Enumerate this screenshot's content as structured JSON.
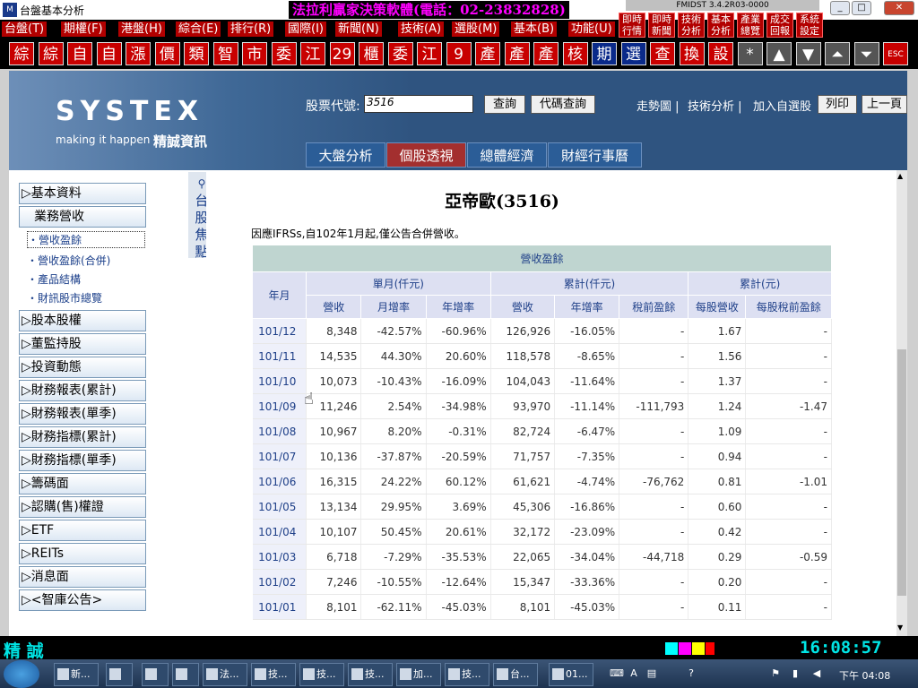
{
  "window": {
    "title": "台盤基本分析",
    "ad": "法拉利贏家決策軟體(電話：02-23832828)",
    "version": "FMIDST 3.4.2R03-0000"
  },
  "menu": [
    "台盤(T)",
    "期權(F)",
    "港盤(H)",
    "綜合(E)",
    "排行(R)",
    "國際(I)",
    "新聞(N)",
    "技術(A)",
    "選股(M)",
    "基本(B)",
    "功能(U)"
  ],
  "quick": [
    "即時行情",
    "即時新聞",
    "技術分析",
    "基本分析",
    "產業總覽",
    "成交回報",
    "系統設定"
  ],
  "toolbar": [
    "綜",
    "綜",
    "自",
    "自",
    "漲",
    "價",
    "類",
    "智",
    "市",
    "委",
    "江",
    "29",
    "櫃",
    "委",
    "江",
    "9",
    "產",
    "產",
    "產",
    "核",
    "期",
    "選",
    "查",
    "換",
    "設",
    "*",
    "▲",
    "▼",
    "⏶",
    "⏷",
    "ESC"
  ],
  "banner": {
    "brand": "SYSTEX",
    "tagline": "making it happen",
    "company": "精誠資訊",
    "stock_label": "股票代號:",
    "stock_value": "3516",
    "query": "查詢",
    "code_query": "代碼查詢",
    "links": [
      "走勢圖 |",
      "技術分析 |",
      "加入自選股"
    ],
    "print": "列印",
    "prev": "上一頁",
    "tabs": [
      "大盤分析",
      "個股透視",
      "總體經濟",
      "財經行事曆"
    ]
  },
  "sidebar": {
    "vtab": [
      "台",
      "股",
      "焦",
      "點"
    ],
    "items": [
      "▷基本資料",
      "業務營收",
      "▷股本股權",
      "▷董監持股",
      "▷投資動態",
      "▷財務報表(累計)",
      "▷財務報表(單季)",
      "▷財務指標(累計)",
      "▷財務指標(單季)",
      "▷籌碼面",
      "▷認購(售)權證",
      "▷ETF",
      "▷REITs",
      "▷消息面",
      "▷<智庫公告>"
    ],
    "subitems": [
      "・營收盈餘",
      "・營收盈餘(合併)",
      "・產品結構",
      "・財訊股市總覽"
    ]
  },
  "content": {
    "title": "亞帝歐(3516)",
    "note": "因應IFRSs,自102年1月起,僅公告合併營收。",
    "table_title": "營收盈餘",
    "group_headers": [
      "年月",
      "單月(仟元)",
      "累計(仟元)",
      "累計(元)"
    ],
    "col_headers": [
      "營收",
      "月增率",
      "年增率",
      "營收",
      "年增率",
      "稅前盈餘",
      "每股營收",
      "每股稅前盈餘"
    ],
    "rows": [
      [
        "101/12",
        "8,348",
        "-42.57%",
        "-60.96%",
        "126,926",
        "-16.05%",
        "-",
        "1.67",
        "-"
      ],
      [
        "101/11",
        "14,535",
        "44.30%",
        "20.60%",
        "118,578",
        "-8.65%",
        "-",
        "1.56",
        "-"
      ],
      [
        "101/10",
        "10,073",
        "-10.43%",
        "-16.09%",
        "104,043",
        "-11.64%",
        "-",
        "1.37",
        "-"
      ],
      [
        "101/09",
        "11,246",
        "2.54%",
        "-34.98%",
        "93,970",
        "-11.14%",
        "-111,793",
        "1.24",
        "-1.47"
      ],
      [
        "101/08",
        "10,967",
        "8.20%",
        "-0.31%",
        "82,724",
        "-6.47%",
        "-",
        "1.09",
        "-"
      ],
      [
        "101/07",
        "10,136",
        "-37.87%",
        "-20.59%",
        "71,757",
        "-7.35%",
        "-",
        "0.94",
        "-"
      ],
      [
        "101/06",
        "16,315",
        "24.22%",
        "60.12%",
        "61,621",
        "-4.74%",
        "-76,762",
        "0.81",
        "-1.01"
      ],
      [
        "101/05",
        "13,134",
        "29.95%",
        "3.69%",
        "45,306",
        "-16.86%",
        "-",
        "0.60",
        "-"
      ],
      [
        "101/04",
        "10,107",
        "50.45%",
        "20.61%",
        "32,172",
        "-23.09%",
        "-",
        "0.42",
        "-"
      ],
      [
        "101/03",
        "6,718",
        "-7.29%",
        "-35.53%",
        "22,065",
        "-34.04%",
        "-44,718",
        "0.29",
        "-0.59"
      ],
      [
        "101/02",
        "7,246",
        "-10.55%",
        "-12.64%",
        "15,347",
        "-33.36%",
        "-",
        "0.20",
        "-"
      ],
      [
        "101/01",
        "8,101",
        "-62.11%",
        "-45.03%",
        "8,101",
        "-45.03%",
        "-",
        "0.11",
        "-"
      ]
    ]
  },
  "status": {
    "label": "精 誠",
    "time": "16:08:57"
  },
  "taskbar": {
    "tasks": [
      "新...",
      "",
      "",
      "",
      "法...",
      "技...",
      "技...",
      "技...",
      "加...",
      "技...",
      "台...",
      "01..."
    ],
    "clock": "下午 04:08"
  }
}
